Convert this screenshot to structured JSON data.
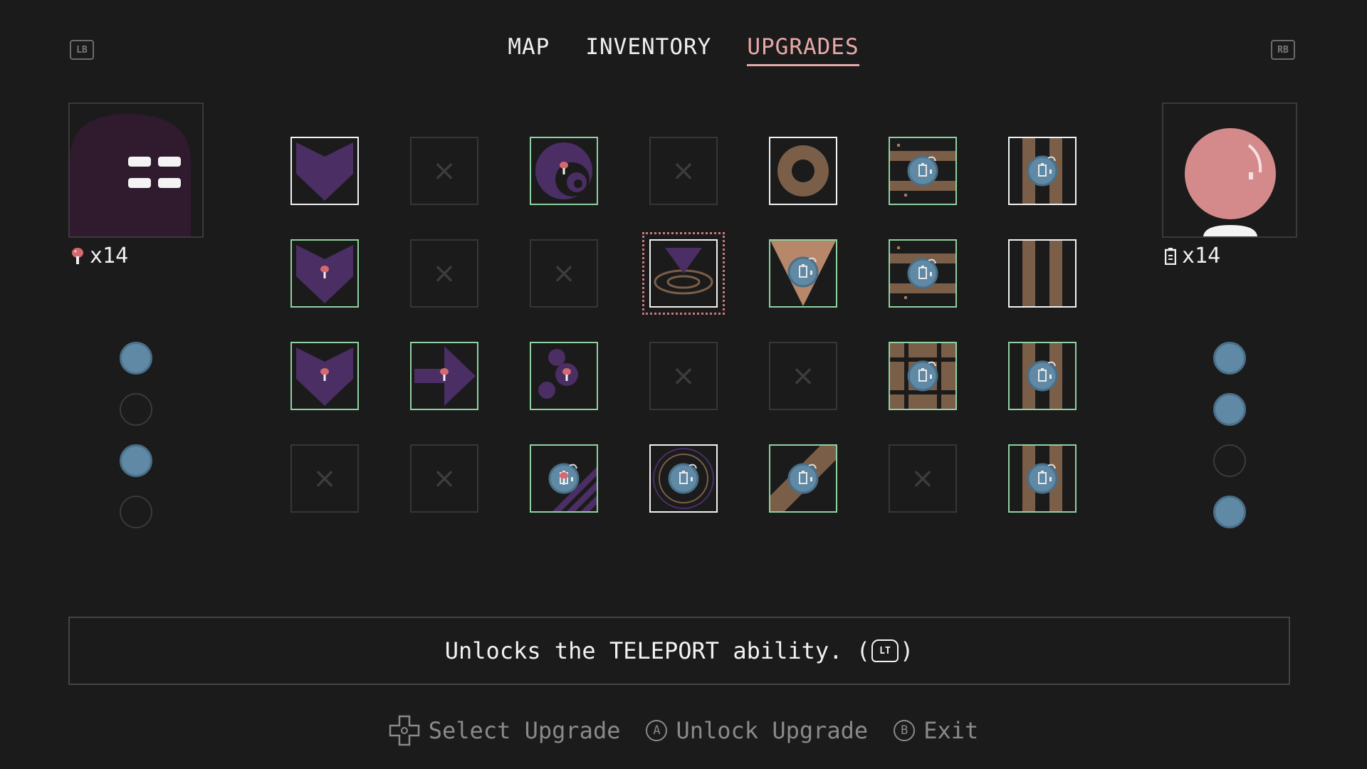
{
  "shoulders": {
    "left": "LB",
    "right": "RB"
  },
  "tabs": [
    {
      "label": "MAP",
      "active": false
    },
    {
      "label": "INVENTORY",
      "active": false
    },
    {
      "label": "UPGRADES",
      "active": true
    }
  ],
  "left_panel": {
    "counter_icon": "mushroom-icon",
    "counter_text": "x14",
    "dots": [
      true,
      false,
      true,
      false
    ],
    "color": "#2f1a2e"
  },
  "right_panel": {
    "counter_icon": "battery-icon",
    "counter_text": "x14",
    "dots": [
      true,
      true,
      false,
      true
    ],
    "color": "#d48a8a"
  },
  "grid": {
    "rows": [
      [
        "heart",
        "locked",
        "swirl-mushroom",
        "locked",
        "donut",
        "bars-bomb",
        "pillar-bomb"
      ],
      [
        "heart-mushroom",
        "locked",
        "locked",
        "triangle-teleport",
        "triangle-bomb",
        "bars-bomb",
        "pillar"
      ],
      [
        "heart-mushroom",
        "arrow-mushroom",
        "spores-mushroom",
        "locked",
        "locked",
        "grid-bomb",
        "pillar-bomb"
      ],
      [
        "locked",
        "locked",
        "stripe-bomb",
        "ring-bomb",
        "diagonal-bomb",
        "locked",
        "pillar-bomb"
      ]
    ],
    "states": [
      [
        "available",
        "locked",
        "owned",
        "locked",
        "available",
        "owned",
        "available"
      ],
      [
        "owned",
        "locked",
        "locked",
        "available",
        "owned",
        "owned",
        "available"
      ],
      [
        "owned",
        "owned",
        "owned",
        "locked",
        "locked",
        "owned",
        "owned"
      ],
      [
        "locked",
        "locked",
        "owned",
        "available",
        "owned",
        "locked",
        "owned"
      ]
    ],
    "selected": [
      1,
      3
    ]
  },
  "description": {
    "before": "Unlocks the TELEPORT ability. (",
    "badge": "LT",
    "after": ")"
  },
  "footer": [
    {
      "icon": "dpad-icon",
      "label": "Select Upgrade"
    },
    {
      "icon": "a-button-icon",
      "glyph": "A",
      "label": "Unlock Upgrade"
    },
    {
      "icon": "b-button-icon",
      "glyph": "B",
      "label": "Exit"
    }
  ],
  "colors": {
    "owned_border": "#8fd1a0",
    "available_border": "#f2f2f2",
    "purple": "#4a2e64",
    "brown": "#7a5e48",
    "bomb_blue": "#5f89a4",
    "accent_pink": "#e8a8a8"
  }
}
